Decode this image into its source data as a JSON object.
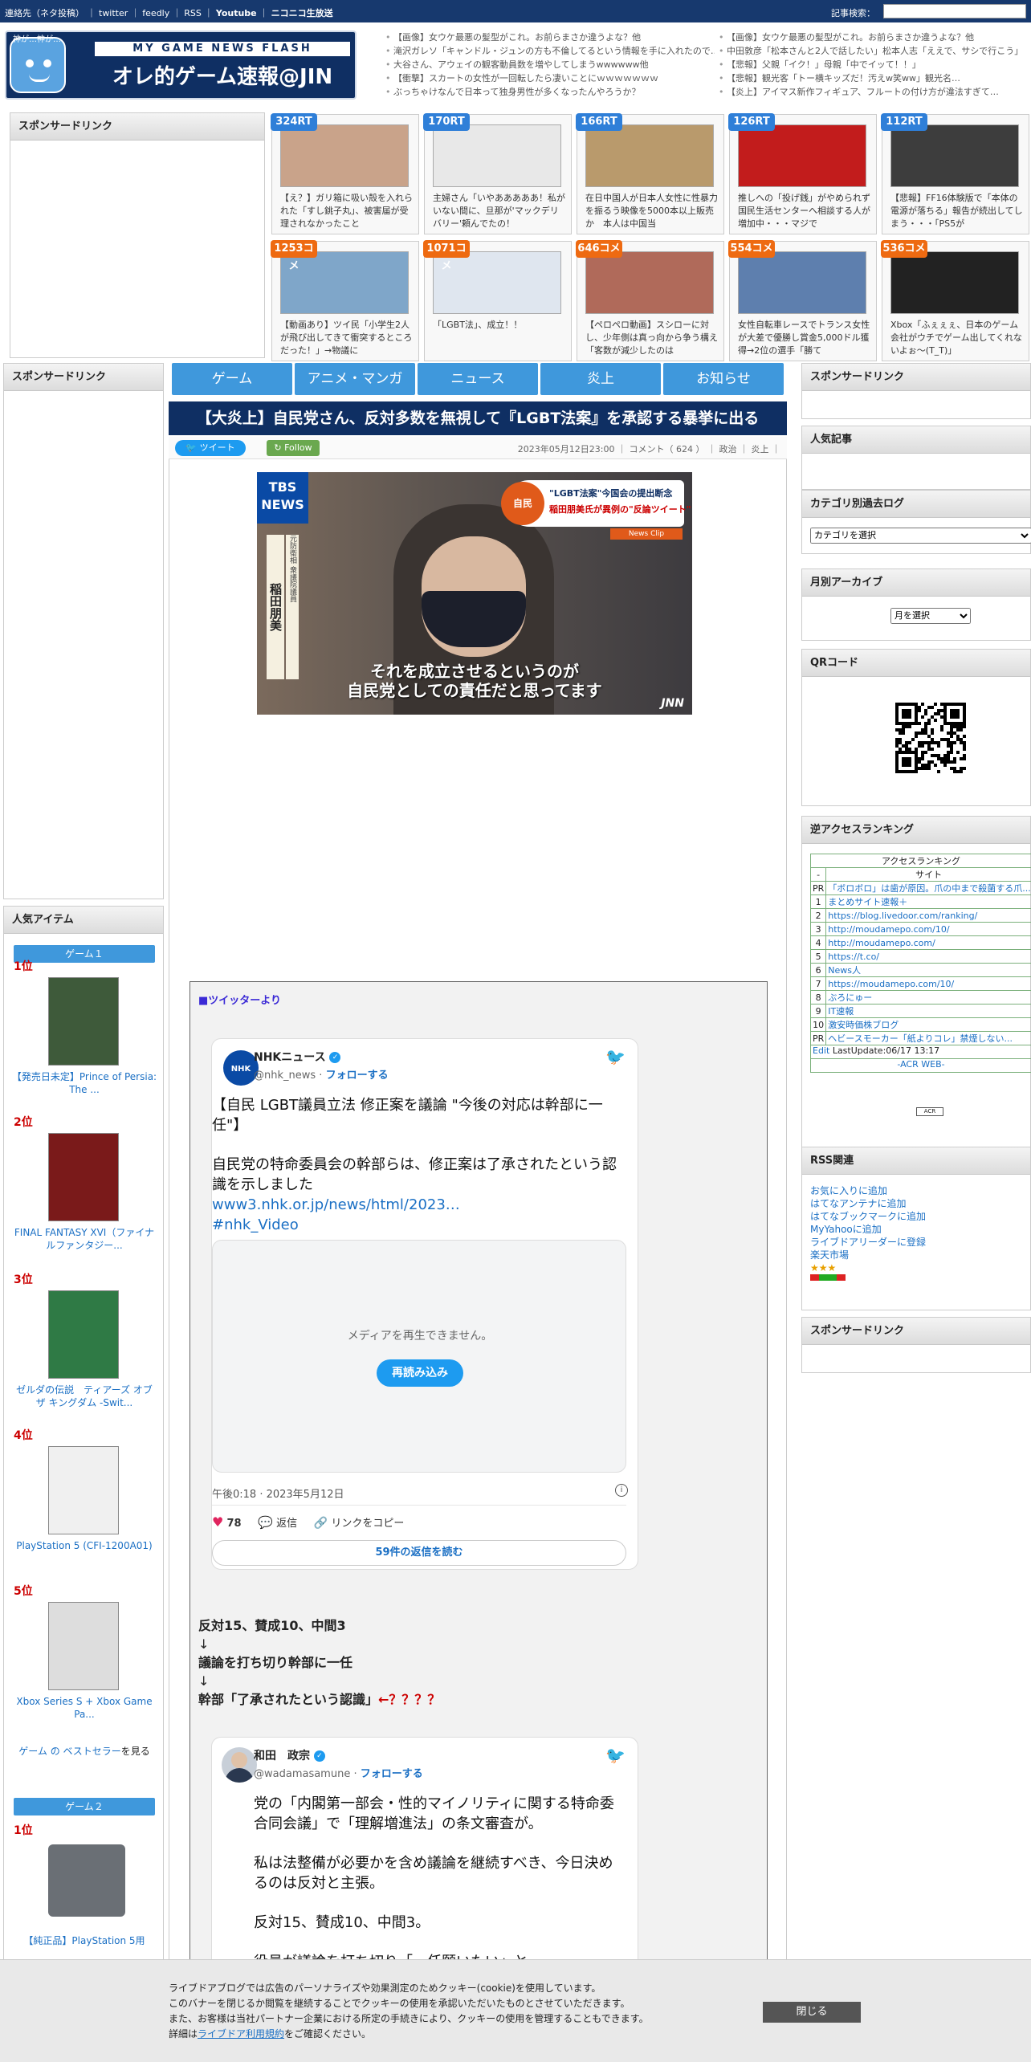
{
  "topbar": {
    "links": [
      "連絡先（ネタ投稿）",
      "twitter",
      "feedly",
      "RSS",
      "Youtube",
      "ニコニコ生放送"
    ],
    "search_label": "記事検索："
  },
  "logo": {
    "mascot_text": "神が…神が…",
    "subtitle": "MY GAME NEWS FLASH",
    "title": "オレ的ゲーム速報@JIN"
  },
  "headlines_left": [
    "【画像】女ウケ最悪の髪型がこれ。お前らまさか違うよな？他",
    "滝沢ガレソ「キャンドル・ジュンの方も不倫してるという情報を手に入れたので…",
    "大谷さん、アウェイの観客動員数を増やしてしまうwwwwww他",
    "【衝撃】スカートの女性が一回転したら凄いことにｗｗｗｗｗｗｗ",
    "ぶっちゃけなんで日本って独身男性が多くなったんやろうか？"
  ],
  "headlines_right": [
    "【画像】女ウケ最悪の髪型がこれ。お前らまさか違うよな？他",
    "中田敦彦「松本さんと2人で話したい」松本人志「ええで、サシで行こう」",
    "【悲報】父親「イク！」母親「中でイッて！！」",
    "【悲報】観光客「トー横キッズだ！汚えw笑ww」観光名…",
    "【炎上】アイマス新作フィギュア、フルートの付け方が違法すぎて…"
  ],
  "sponsor": {
    "label": "スポンサードリンク"
  },
  "cards": [
    {
      "badge": "324RT",
      "text": "【え？】ガリ箱に吸い殻を入れられた「すし銚子丸」、被害届が受理されなかったこと",
      "thumb": "#c9a38a"
    },
    {
      "badge": "170RT",
      "text": "主婦さん「いやあああああ！私がいない間に、旦那が'マックデリバリー'頼んでたの！",
      "thumb": "#e8e8e8"
    },
    {
      "badge": "166RT",
      "text": "在日中国人が日本人女性に性暴力を振るう映像を5000本以上販売か　本人は中国当",
      "thumb": "#b99a6c"
    },
    {
      "badge": "126RT",
      "text": "推しへの「投げ銭」がやめられず国民生活センターへ相談する人が増加中・・・マジで",
      "thumb": "#c21c1c"
    },
    {
      "badge": "112RT",
      "text": "【悲報】FF16体験版で「本体の電源が落ちる」報告が続出してしまう・・・「PS5が",
      "thumb": "#3d3d3d"
    },
    {
      "badge": "1253コメ",
      "text": "【動画あり】ツイ民「小学生2人が飛び出してきて衝突するところだった！」→物議に",
      "thumb": "#7fa6c9"
    },
    {
      "badge": "1071コメ",
      "text": "「LGBT法」、成立！！",
      "thumb": "#dfe6ef"
    },
    {
      "badge": "646コメ",
      "text": "【ペロペロ動画】スシローに対し、少年側は真っ向から争う構え「客数が減少したのは",
      "thumb": "#b06a5a"
    },
    {
      "badge": "554コメ",
      "text": "女性自転車レースでトランス女性が大差で優勝し賞金5,000ドル獲得→2位の選手「勝て",
      "thumb": "#5e7fae"
    },
    {
      "badge": "536コメ",
      "text": "Xbox「ふぇぇぇ、日本のゲーム会社がウチでゲーム出してくれないよぉ～(T_T)」",
      "thumb": "#222222"
    }
  ],
  "nav": [
    "ゲーム",
    "アニメ・マンガ",
    "ニュース",
    "炎上",
    "お知らせ"
  ],
  "article": {
    "title": "【大炎上】自民党さん、反対多数を無視して『LGBT法案』を承認する暴挙に出る",
    "tweet_btn": "ツイート",
    "follow_btn": "Follow",
    "date": "2023年05月12日23:00",
    "comment": "コメント（ 624 ）",
    "cat1": "政治",
    "cat2": "炎上",
    "image": {
      "station": "TBS NEWS",
      "banner1": "\"LGBT法案\"今国会の提出断念",
      "banner2": "稲田朋美氏が異例の\"反論ツイート\"",
      "tag": "自民",
      "newsclip": "News Clip",
      "name": "稲田朋美",
      "name_sub": "元防衛相 衆議院議員",
      "caption1": "それを成立させるというのが",
      "caption2": "自民党としての責任だと思ってます",
      "watermark": "JNN"
    },
    "tweet_section_label": "■ツイッターより",
    "tweet1": {
      "avatar": "NHK NEWS",
      "name": "NHKニュース",
      "handle": "@nhk_news",
      "follow": "フォローする",
      "text1": "【自民 LGBT議員立法 修正案を議論 \"今後の対応は幹部に一任\"】",
      "text2": "自民党の特命委員会の幹部らは、修正案は了承されたという認識を示しました",
      "link": "www3.nhk.or.jp/news/html/2023…",
      "hashtag": "#nhk_Video",
      "media_msg": "メディアを再生できません。",
      "reload": "再読み込み",
      "time": "午後0:18 · 2023年5月12日",
      "likes": "78",
      "reply": "返信",
      "copy": "リンクをコピー",
      "read_replies": "59件の返信を読む"
    },
    "body_lines": [
      "反対15、賛成10、中間3",
      "↓",
      "議論を打ち切り幹部に一任",
      "↓",
      "幹部「了承されたという認識」"
    ],
    "question": "←？？？？",
    "tweet2": {
      "name": "和田　政宗",
      "handle": "@wadamasamune",
      "follow": "フォローする",
      "p1": "党の「内閣第一部会・性的マイノリティに関する特命委合同会議」で「理解増進法」の条文審査が。",
      "p2": "私は法整備が必要かを含め議論を継続すべき、今日決めるのは反対と主張。",
      "p3": "反対15、賛成10、中間3。",
      "p4": "役員が議論を打ち切り「一任願いたい」と"
    }
  },
  "left_sidebar": {
    "sponsor": "スポンサードリンク",
    "popular": "人気アイテム",
    "game1": "ゲーム１",
    "game2": "ゲーム２",
    "ranks": [
      "1位",
      "2位",
      "3位",
      "4位",
      "5位"
    ],
    "items": [
      {
        "title": "【発売日未定】Prince of Persia: The ...",
        "color": "#3e5a3a"
      },
      {
        "title": "FINAL FANTASY XVI（ファイナルファンタジー...",
        "color": "#7a1a1a"
      },
      {
        "title": "ゼルダの伝説　ティアーズ オブ ザ キングダム -Swit...",
        "color": "#2f7a45"
      },
      {
        "title": "PlayStation 5 (CFI-1200A01)",
        "color": "#f0f0f0"
      },
      {
        "title": "Xbox Series S + Xbox Game Pa...",
        "color": "#dddddd"
      }
    ],
    "bestseller_link": "ゲーム の ベストセラー",
    "bestseller_tail": "を見る",
    "g2_rank": "1位",
    "g2_title": "【純正品】PlayStation 5用"
  },
  "right_sidebar": {
    "sponsor": "スポンサードリンク",
    "popular": "人気記事",
    "category": "カテゴリ別過去ログ",
    "category_select": "カテゴリを選択",
    "monthly": "月別アーカイブ",
    "month_select": "月を選択",
    "qr": "QRコード",
    "ranking": "逆アクセスランキング",
    "acr_title": "アクセスランキング",
    "acr_header": "サイト",
    "acr_rows": [
      {
        "rank": "PR",
        "site": "「ボロボロ」は歯が原因。爪の中まで殺菌する爪..."
      },
      {
        "rank": "1",
        "site": "まとめサイト速報＋"
      },
      {
        "rank": "2",
        "site": "https://blog.livedoor.com/ranking/"
      },
      {
        "rank": "3",
        "site": "http://moudamepo.com/10/"
      },
      {
        "rank": "4",
        "site": "http://moudamepo.com/"
      },
      {
        "rank": "5",
        "site": "https://t.co/"
      },
      {
        "rank": "6",
        "site": "News人"
      },
      {
        "rank": "7",
        "site": "https://moudamepo.com/10/"
      },
      {
        "rank": "8",
        "site": "ぶろにゅー"
      },
      {
        "rank": "9",
        "site": "IT速報"
      },
      {
        "rank": "10",
        "site": "激安時価株ブログ"
      },
      {
        "rank": "PR",
        "site": "ヘビースモーカー「紙よりコレ」禁煙しない..."
      }
    ],
    "acr_edit": "Edit",
    "acr_update": "LastUpdate:06/17 13:17",
    "acr_web": "-ACR WEB-",
    "rss": "RSS関連",
    "rss_links": [
      "お気に入りに追加",
      "はてなアンテナに追加",
      "はてなブックマークに追加",
      "MyYahooに追加",
      "ライブドアリーダーに登録",
      "楽天市場"
    ],
    "sponsor2": "スポンサードリンク"
  },
  "cookie": {
    "line1": "ライブドアブログでは広告のパーソナライズや効果測定のためクッキー(cookie)を使用しています。",
    "line2": "このバナーを閉じるか閲覧を継続することでクッキーの使用を承認いただいたものとさせていただきます。",
    "line3": "また、お客様は当社パートナー企業における所定の手続きにより、クッキーの使用を管理することもできます。",
    "line4_pre": "詳細は",
    "line4_link": "ライブドア利用規約",
    "line4_post": "をご確認ください。",
    "close": "閉じる"
  }
}
